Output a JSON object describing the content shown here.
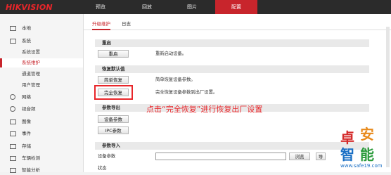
{
  "header": {
    "logo": "HIKVISION",
    "nav": [
      "预览",
      "回放",
      "图片",
      "配置"
    ]
  },
  "sidebar": {
    "items": [
      {
        "label": "本地",
        "icon": "monitor-icon"
      },
      {
        "label": "系统",
        "icon": "system-icon"
      },
      {
        "label": "系统设置"
      },
      {
        "label": "系统维护"
      },
      {
        "label": "通道管理"
      },
      {
        "label": "用户管理"
      },
      {
        "label": "网络",
        "icon": "globe-icon"
      },
      {
        "label": "视音频",
        "icon": "audio-video-icon"
      },
      {
        "label": "图像",
        "icon": "image-icon"
      },
      {
        "label": "事件",
        "icon": "event-icon"
      },
      {
        "label": "存储",
        "icon": "storage-icon"
      },
      {
        "label": "车辆检测",
        "icon": "vehicle-icon"
      },
      {
        "label": "智能分析",
        "icon": "smart-icon"
      }
    ]
  },
  "tabs": [
    "升级维护",
    "日志"
  ],
  "sections": {
    "reboot": {
      "title": "重启",
      "button": "重启",
      "desc": "重新启动设备。"
    },
    "restore": {
      "title": "恢复默认值",
      "simple_button": "简单恢复",
      "simple_desc": "简单恢复设备参数。",
      "full_button": "完全恢复",
      "full_desc": "完全恢复设备参数到出厂设置。"
    },
    "export": {
      "title": "参数导出",
      "device_button": "设备参数",
      "ipc_button": "IPC参数"
    },
    "import": {
      "title": "参数导入",
      "label": "设备参数",
      "browse_button": "浏览",
      "import_button": "导",
      "status_label": "状态"
    }
  },
  "annotation": "点击“完全恢复”进行恢复出厂设置",
  "watermark": {
    "chars": [
      "卓",
      "安",
      "智",
      "能"
    ],
    "url": "www.safe19.com"
  },
  "colors": {
    "accent": "#c8252c",
    "annotation": "#e8262a",
    "topbar": "#2b2b2b"
  }
}
